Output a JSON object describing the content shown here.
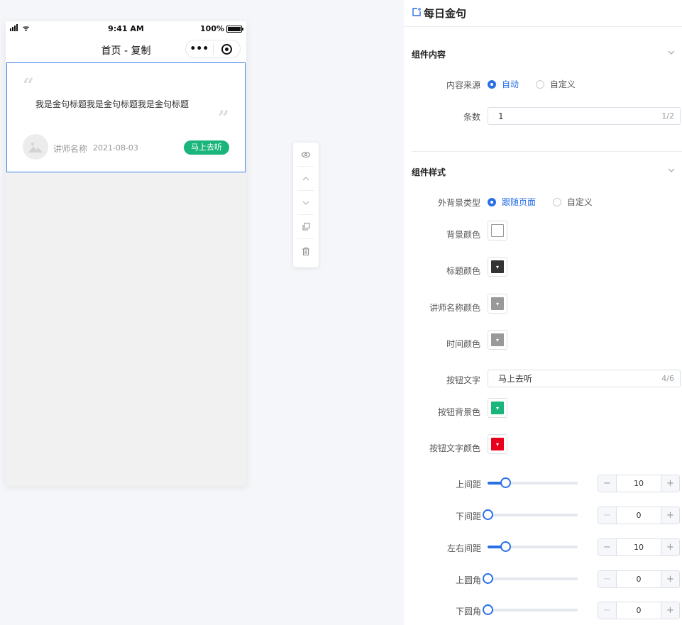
{
  "phone": {
    "time": "9:41 AM",
    "battery": "100%",
    "battery_level": 1.0,
    "nav_title": "首页 - 复制",
    "capsule_more": "•••",
    "card": {
      "quote_open": "“",
      "quote_close": "”",
      "title": "我是金句标题我是金句标题我是金句标题",
      "lecturer": "讲师名称",
      "date": "2021-08-03",
      "button": "马上去听",
      "button_color": "#19b57a"
    }
  },
  "toolbar": {
    "items": [
      "eye-icon",
      "arrow-up-icon",
      "arrow-down-icon",
      "copy-icon",
      "trash-icon"
    ]
  },
  "panel": {
    "title": "每日金句",
    "section_content": {
      "title": "组件内容",
      "source_label": "内容来源",
      "source_options": [
        "自动",
        "自定义"
      ],
      "source_selected": "自动",
      "count_label": "条数",
      "count_value": "1",
      "count_counter": "1/2"
    },
    "section_style": {
      "title": "组件样式",
      "bgtype_label": "外背景类型",
      "bgtype_options": [
        "跟随页面",
        "自定义"
      ],
      "bgtype_selected": "跟随页面",
      "bg_color_label": "背景颜色",
      "bg_color": "#ffffff",
      "title_color_label": "标题颜色",
      "title_color": "#333333",
      "lecturer_color_label": "讲师名称颜色",
      "lecturer_color": "#999999",
      "time_color_label": "时间颜色",
      "time_color": "#999999",
      "btn_text_label": "按钮文字",
      "btn_text_value": "马上去听",
      "btn_text_counter": "4/6",
      "btn_bg_label": "按钮背景色",
      "btn_bg_color": "#19b57a",
      "btn_text_color_label": "按钮文字颜色",
      "btn_text_color": "#e8001c",
      "sliders": [
        {
          "label": "上间距",
          "value": "10",
          "max": 50
        },
        {
          "label": "下间距",
          "value": "0",
          "max": 50
        },
        {
          "label": "左右间距",
          "value": "10",
          "max": 50
        },
        {
          "label": "上圆角",
          "value": "0",
          "max": 50
        },
        {
          "label": "下圆角",
          "value": "0",
          "max": 50
        }
      ],
      "minus": "−",
      "plus": "+"
    }
  }
}
